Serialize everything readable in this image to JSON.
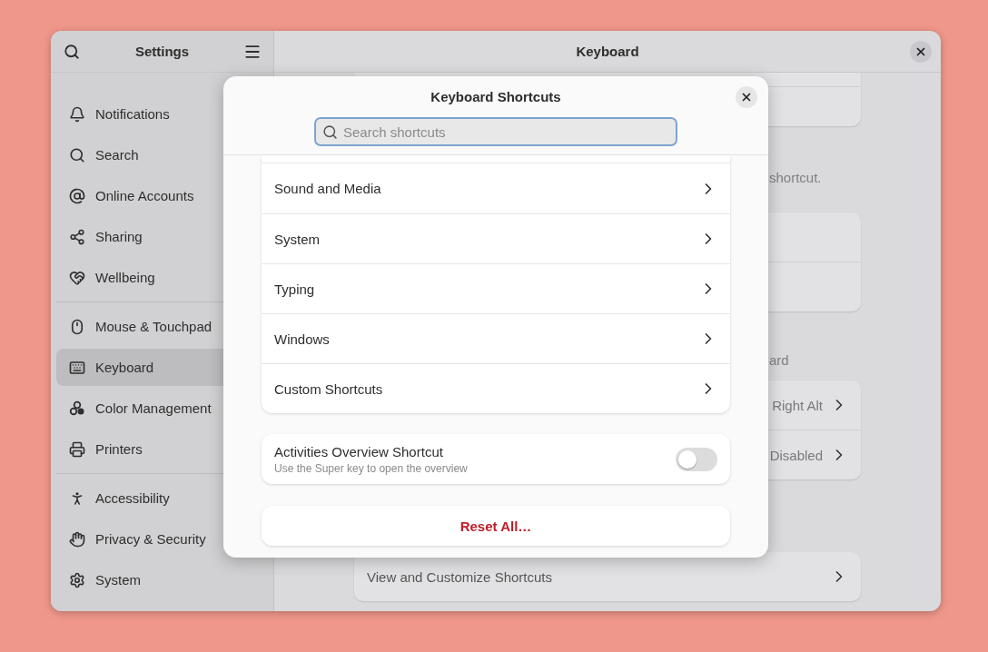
{
  "sidebar": {
    "title": "Settings",
    "groups": [
      {
        "items": [
          {
            "label": "Notifications",
            "selected": false
          },
          {
            "label": "Search",
            "selected": false
          },
          {
            "label": "Online Accounts",
            "selected": false
          },
          {
            "label": "Sharing",
            "selected": false
          },
          {
            "label": "Wellbeing",
            "selected": false
          }
        ]
      },
      {
        "items": [
          {
            "label": "Mouse & Touchpad",
            "selected": false
          },
          {
            "label": "Keyboard",
            "selected": true
          },
          {
            "label": "Color Management",
            "selected": false
          },
          {
            "label": "Printers",
            "selected": false
          }
        ]
      },
      {
        "items": [
          {
            "label": "Accessibility",
            "selected": false
          },
          {
            "label": "Privacy & Security",
            "selected": false
          },
          {
            "label": "System",
            "selected": false
          }
        ]
      }
    ]
  },
  "main": {
    "title": "Keyboard",
    "sections": [
      {
        "kind": "card",
        "rows": [
          {},
          {}
        ]
      },
      {
        "kind": "caption",
        "text": "shortcut."
      },
      {
        "kind": "card",
        "rows": [
          {},
          {}
        ]
      },
      {
        "kind": "caption",
        "text": "ard"
      },
      {
        "kind": "card",
        "rows": [
          {
            "value": "Right Alt"
          },
          {
            "value": "Disabled"
          }
        ]
      },
      {
        "kind": "card",
        "rows": [
          {
            "label": "View and Customize Shortcuts"
          }
        ]
      }
    ]
  },
  "dialog": {
    "title": "Keyboard Shortcuts",
    "search": {
      "placeholder": "Search shortcuts"
    },
    "categories": [
      {
        "label": "Sound and Media"
      },
      {
        "label": "System"
      },
      {
        "label": "Typing"
      },
      {
        "label": "Windows"
      },
      {
        "label": "Custom Shortcuts"
      }
    ],
    "toggle": {
      "title": "Activities Overview Shortcut",
      "subtitle": "Use the Super key to open the overview",
      "on": false
    },
    "reset": "Reset All…"
  }
}
